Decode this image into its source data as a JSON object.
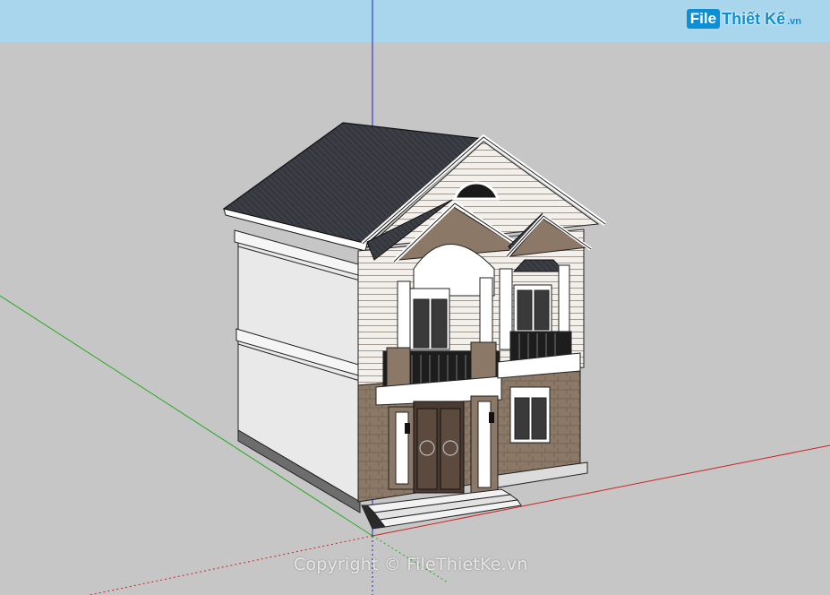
{
  "viewport": {
    "sky_color": "#a9d6ec",
    "ground_color": "#c7c6c6"
  },
  "axes": {
    "red_axis_color": "#cc2222",
    "green_axis_color": "#22aa22",
    "blue_axis_color": "#2222cc"
  },
  "model": {
    "name": "two-storey-villa",
    "roof_color": "#3b3d44",
    "wall_color": "#ececec",
    "stone_color": "#8a7765",
    "trim_color": "#ffffff"
  },
  "watermark": {
    "logo_box": "File",
    "logo_text": "Thiết Kế",
    "logo_tld": ".vn",
    "copyright": "Copyright © FileThietKe.vn"
  }
}
